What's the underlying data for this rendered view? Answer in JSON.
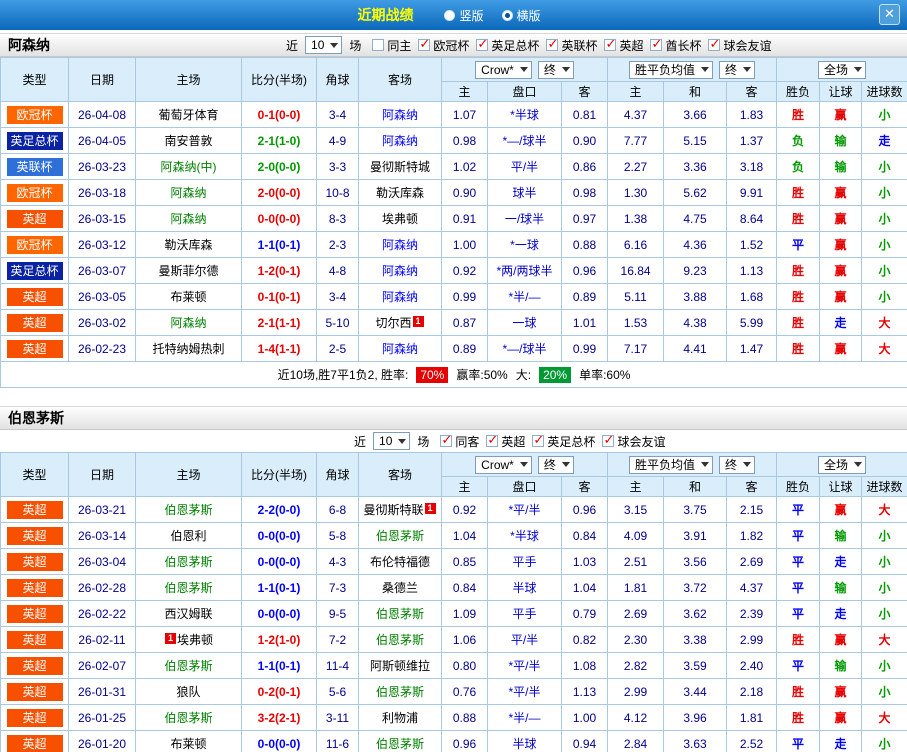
{
  "titlebar": {
    "title": "近期战绩",
    "vertical_label": "竖版",
    "horizontal_label": "横版",
    "selected": "横版",
    "close_glyph": "✕"
  },
  "headers": {
    "type": "类型",
    "date": "日期",
    "home": "主场",
    "score": "比分(半场)",
    "corner": "角球",
    "away": "客场",
    "odds_source": "Crow*",
    "final": "终",
    "avg": "胜平负均值",
    "full": "全场",
    "sub": [
      "主",
      "盘口",
      "客",
      "主",
      "和",
      "客",
      "胜负",
      "让球",
      "进球数"
    ]
  },
  "league_colors": {
    "欧冠杯": "#ff6600",
    "英足总杯": "#0a23a5",
    "英联杯": "#2e6fd8",
    "英超": "#f75000"
  },
  "result_colors": {
    "胜": "#e60000",
    "赢": "#e60000",
    "大": "#e60000",
    "负": "#009900",
    "输": "#009900",
    "小": "#009900",
    "平": "#0000ff",
    "走": "#0000ff"
  },
  "sections": [
    {
      "team": "阿森纳",
      "filter": {
        "near": "近",
        "count": "10",
        "unit": "场",
        "position": "bar",
        "options": [
          {
            "label": "同主",
            "checked": false
          },
          {
            "label": "欧冠杯",
            "checked": true
          },
          {
            "label": "英足总杯",
            "checked": true
          },
          {
            "label": "英联杯",
            "checked": true
          },
          {
            "label": "英超",
            "checked": true
          },
          {
            "label": "酋长杯",
            "checked": true
          },
          {
            "label": "球会友谊",
            "checked": true
          }
        ]
      },
      "rows": [
        {
          "league": "欧冠杯",
          "date": "26-04-08",
          "home": "葡萄牙体育",
          "home_color": "#000000",
          "score": "0-1(0-0)",
          "corner": "3-4",
          "away": "阿森纳",
          "away_color": "#0000ff",
          "odds": [
            "1.07",
            "*半球",
            "0.81"
          ],
          "avg": [
            "4.37",
            "3.66",
            "1.83"
          ],
          "results": [
            "胜",
            "赢",
            "小"
          ]
        },
        {
          "league": "英足总杯",
          "date": "26-04-05",
          "home": "南安普敦",
          "home_color": "#000000",
          "score": "2-1(1-0)",
          "corner": "4-9",
          "away": "阿森纳",
          "away_color": "#0000ff",
          "odds": [
            "0.98",
            "*—/球半",
            "0.90"
          ],
          "avg": [
            "7.77",
            "5.15",
            "1.37"
          ],
          "results": [
            "负",
            "输",
            "走"
          ]
        },
        {
          "league": "英联杯",
          "date": "26-03-23",
          "home": "阿森纳(中)",
          "home_color": "#008000",
          "score": "2-0(0-0)",
          "corner": "3-3",
          "away": "曼彻斯特城",
          "away_color": "#000000",
          "odds": [
            "1.02",
            "平/半",
            "0.86"
          ],
          "avg": [
            "2.27",
            "3.36",
            "3.18"
          ],
          "results": [
            "负",
            "输",
            "小"
          ]
        },
        {
          "league": "欧冠杯",
          "date": "26-03-18",
          "home": "阿森纳",
          "home_color": "#008000",
          "score": "2-0(0-0)",
          "corner": "10-8",
          "away": "勒沃库森",
          "away_color": "#000000",
          "odds": [
            "0.90",
            "球半",
            "0.98"
          ],
          "avg": [
            "1.30",
            "5.62",
            "9.91"
          ],
          "results": [
            "胜",
            "赢",
            "小"
          ]
        },
        {
          "league": "英超",
          "date": "26-03-15",
          "home": "阿森纳",
          "home_color": "#008000",
          "score": "0-0(0-0)",
          "corner": "8-3",
          "away": "埃弗顿",
          "away_color": "#000000",
          "odds": [
            "0.91",
            "一/球半",
            "0.97"
          ],
          "avg": [
            "1.38",
            "4.75",
            "8.64"
          ],
          "results": [
            "胜",
            "赢",
            "小"
          ]
        },
        {
          "league": "欧冠杯",
          "date": "26-03-12",
          "home": "勒沃库森",
          "home_color": "#000000",
          "score": "1-1(0-1)",
          "corner": "2-3",
          "away": "阿森纳",
          "away_color": "#0000ff",
          "odds": [
            "1.00",
            "*一球",
            "0.88"
          ],
          "avg": [
            "6.16",
            "4.36",
            "1.52"
          ],
          "results": [
            "平",
            "赢",
            "小"
          ]
        },
        {
          "league": "英足总杯",
          "date": "26-03-07",
          "home": "曼斯菲尔德",
          "home_color": "#000000",
          "score": "1-2(0-1)",
          "corner": "4-8",
          "away": "阿森纳",
          "away_color": "#0000ff",
          "odds": [
            "0.92",
            "*两/两球半",
            "0.96"
          ],
          "avg": [
            "16.84",
            "9.23",
            "1.13"
          ],
          "results": [
            "胜",
            "赢",
            "小"
          ]
        },
        {
          "league": "英超",
          "date": "26-03-05",
          "home": "布莱顿",
          "home_color": "#000000",
          "score": "0-1(0-1)",
          "corner": "3-4",
          "away": "阿森纳",
          "away_color": "#0000ff",
          "odds": [
            "0.99",
            "*半/—",
            "0.89"
          ],
          "avg": [
            "5.11",
            "3.88",
            "1.68"
          ],
          "results": [
            "胜",
            "赢",
            "小"
          ]
        },
        {
          "league": "英超",
          "date": "26-03-02",
          "home": "阿森纳",
          "home_color": "#008000",
          "score": "2-1(1-1)",
          "corner": "5-10",
          "away": "切尔西",
          "away_color": "#000000",
          "away_badge": "1",
          "odds": [
            "0.87",
            "一球",
            "1.01"
          ],
          "avg": [
            "1.53",
            "4.38",
            "5.99"
          ],
          "results": [
            "胜",
            "走",
            "大"
          ]
        },
        {
          "league": "英超",
          "date": "26-02-23",
          "home": "托特纳姆热刺",
          "home_color": "#000000",
          "score": "1-4(1-1)",
          "corner": "2-5",
          "away": "阿森纳",
          "away_color": "#0000ff",
          "odds": [
            "0.89",
            "*—/球半",
            "0.99"
          ],
          "avg": [
            "7.17",
            "4.41",
            "1.47"
          ],
          "results": [
            "胜",
            "赢",
            "大"
          ]
        }
      ],
      "summary": [
        {
          "t": "近10场,胜7平1负2, 胜率:"
        },
        {
          "t": "70%",
          "bg": "#e60000"
        },
        {
          "t": "赢率:50%"
        },
        {
          "t": "大:"
        },
        {
          "t": "20%",
          "bg": "#009933"
        },
        {
          "t": "单率:60%"
        }
      ]
    },
    {
      "team": "伯恩茅斯",
      "filter": {
        "near": "近",
        "count": "10",
        "unit": "场",
        "position": "below",
        "options": [
          {
            "label": "同客",
            "checked": true
          },
          {
            "label": "英超",
            "checked": true
          },
          {
            "label": "英足总杯",
            "checked": true
          },
          {
            "label": "球会友谊",
            "checked": true
          }
        ]
      },
      "rows": [
        {
          "league": "英超",
          "date": "26-03-21",
          "home": "伯恩茅斯",
          "home_color": "#008000",
          "score": "2-2(0-0)",
          "corner": "6-8",
          "away": "曼彻斯特联",
          "away_color": "#000000",
          "away_badge": "1",
          "odds": [
            "0.92",
            "*平/半",
            "0.96"
          ],
          "avg": [
            "3.15",
            "3.75",
            "2.15"
          ],
          "results": [
            "平",
            "赢",
            "大"
          ]
        },
        {
          "league": "英超",
          "date": "26-03-14",
          "home": "伯恩利",
          "home_color": "#000000",
          "score": "0-0(0-0)",
          "corner": "5-8",
          "away": "伯恩茅斯",
          "away_color": "#008000",
          "odds": [
            "1.04",
            "*半球",
            "0.84"
          ],
          "avg": [
            "4.09",
            "3.91",
            "1.82"
          ],
          "results": [
            "平",
            "输",
            "小"
          ]
        },
        {
          "league": "英超",
          "date": "26-03-04",
          "home": "伯恩茅斯",
          "home_color": "#008000",
          "score": "0-0(0-0)",
          "corner": "4-3",
          "away": "布伦特福德",
          "away_color": "#000000",
          "odds": [
            "0.85",
            "平手",
            "1.03"
          ],
          "avg": [
            "2.51",
            "3.56",
            "2.69"
          ],
          "results": [
            "平",
            "走",
            "小"
          ]
        },
        {
          "league": "英超",
          "date": "26-02-28",
          "home": "伯恩茅斯",
          "home_color": "#008000",
          "score": "1-1(0-1)",
          "corner": "7-3",
          "away": "桑德兰",
          "away_color": "#000000",
          "odds": [
            "0.84",
            "半球",
            "1.04"
          ],
          "avg": [
            "1.81",
            "3.72",
            "4.37"
          ],
          "results": [
            "平",
            "输",
            "小"
          ]
        },
        {
          "league": "英超",
          "date": "26-02-22",
          "home": "西汉姆联",
          "home_color": "#000000",
          "score": "0-0(0-0)",
          "corner": "9-5",
          "away": "伯恩茅斯",
          "away_color": "#008000",
          "odds": [
            "1.09",
            "平手",
            "0.79"
          ],
          "avg": [
            "2.69",
            "3.62",
            "2.39"
          ],
          "results": [
            "平",
            "走",
            "小"
          ]
        },
        {
          "league": "英超",
          "date": "26-02-11",
          "home": "埃弗顿",
          "home_color": "#000000",
          "home_badge": "1",
          "score": "1-2(1-0)",
          "corner": "7-2",
          "away": "伯恩茅斯",
          "away_color": "#008000",
          "odds": [
            "1.06",
            "平/半",
            "0.82"
          ],
          "avg": [
            "2.30",
            "3.38",
            "2.99"
          ],
          "results": [
            "胜",
            "赢",
            "大"
          ]
        },
        {
          "league": "英超",
          "date": "26-02-07",
          "home": "伯恩茅斯",
          "home_color": "#008000",
          "score": "1-1(0-1)",
          "corner": "11-4",
          "away": "阿斯顿维拉",
          "away_color": "#000000",
          "odds": [
            "0.80",
            "*平/半",
            "1.08"
          ],
          "avg": [
            "2.82",
            "3.59",
            "2.40"
          ],
          "results": [
            "平",
            "输",
            "小"
          ]
        },
        {
          "league": "英超",
          "date": "26-01-31",
          "home": "狼队",
          "home_color": "#000000",
          "score": "0-2(0-1)",
          "corner": "5-6",
          "away": "伯恩茅斯",
          "away_color": "#008000",
          "odds": [
            "0.76",
            "*平/半",
            "1.13"
          ],
          "avg": [
            "2.99",
            "3.44",
            "2.18"
          ],
          "results": [
            "胜",
            "赢",
            "小"
          ]
        },
        {
          "league": "英超",
          "date": "26-01-25",
          "home": "伯恩茅斯",
          "home_color": "#008000",
          "score": "3-2(2-1)",
          "corner": "3-11",
          "away": "利物浦",
          "away_color": "#000000",
          "odds": [
            "0.88",
            "*半/—",
            "1.00"
          ],
          "avg": [
            "4.12",
            "3.96",
            "1.81"
          ],
          "results": [
            "胜",
            "赢",
            "大"
          ]
        },
        {
          "league": "英超",
          "date": "26-01-20",
          "home": "布莱顿",
          "home_color": "#000000",
          "score": "0-0(0-0)",
          "corner": "11-6",
          "away": "伯恩茅斯",
          "away_color": "#008000",
          "odds": [
            "0.96",
            "半球",
            "0.94"
          ],
          "avg": [
            "2.84",
            "3.63",
            "2.52"
          ],
          "results": [
            "平",
            "走",
            "小"
          ]
        }
      ]
    }
  ]
}
